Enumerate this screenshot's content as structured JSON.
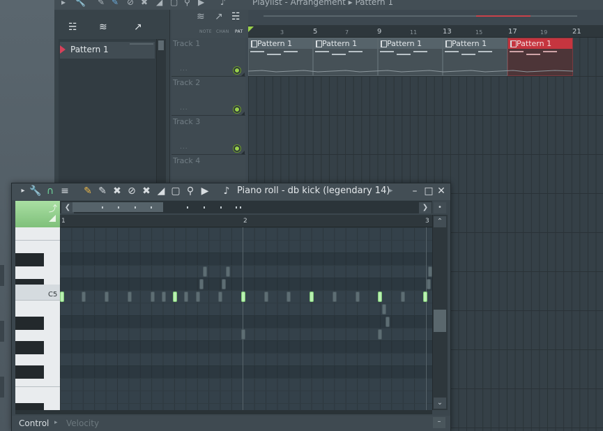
{
  "playlist": {
    "title": "Playlist - Arrangement ▸ Pattern 1",
    "picker_pattern": "Pattern 1",
    "tool_labels": {
      "note": "NOTE",
      "chan": "CHAN",
      "pat": "PAT"
    },
    "tracks": [
      {
        "name": "Track 1",
        "dots": "..."
      },
      {
        "name": "Track 2",
        "dots": "..."
      },
      {
        "name": "Track 3",
        "dots": "..."
      },
      {
        "name": "Track 4",
        "dots": ""
      }
    ],
    "ruler": [
      "3",
      "5",
      "7",
      "9",
      "11",
      "13",
      "15",
      "17",
      "19",
      "21"
    ],
    "clips": [
      {
        "label": "Pattern 1",
        "selected": false
      },
      {
        "label": "Pattern 1",
        "selected": false
      },
      {
        "label": "Pattern 1",
        "selected": false
      },
      {
        "label": "Pattern 1",
        "selected": false
      },
      {
        "label": "Pattern 1",
        "selected": true
      }
    ],
    "colors": {
      "accent_green": "#9ad14a",
      "selected_clip": "#c6353f"
    }
  },
  "piano_roll": {
    "title": "Piano roll - db kick (legendary 14)",
    "ruler": [
      "1",
      "2",
      "3"
    ],
    "key_label": "C5",
    "control_label": "Control",
    "control_target": "Velocity",
    "note_color": "#b9f0b1"
  }
}
